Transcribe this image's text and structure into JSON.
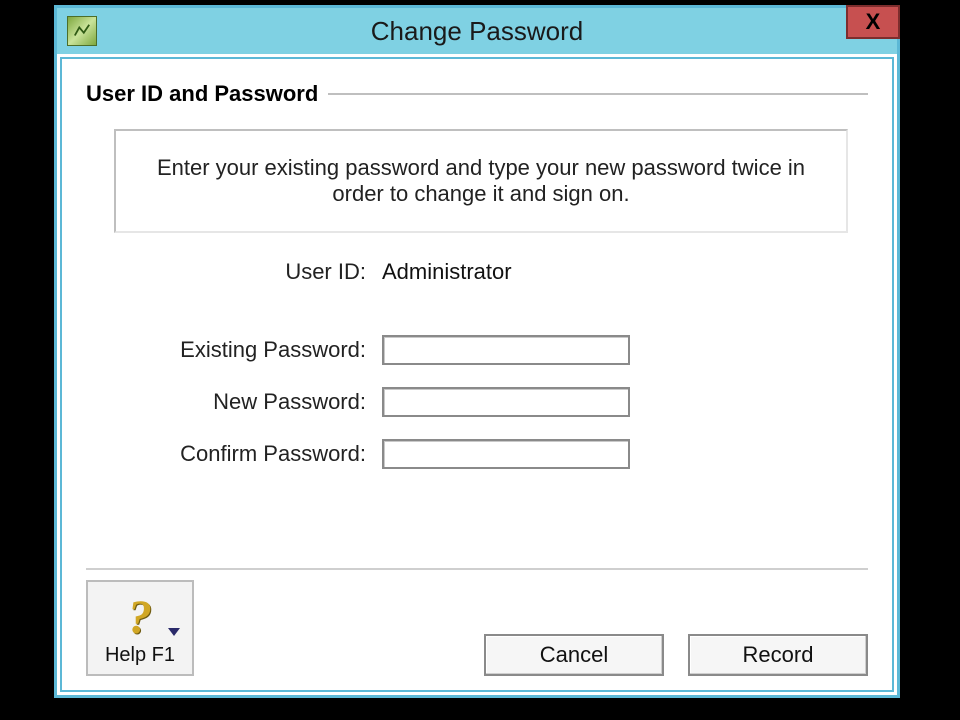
{
  "window": {
    "title": "Change Password",
    "close_symbol": "X"
  },
  "group_title": "User ID and Password",
  "instruction": "Enter your existing password and type your new password twice in order to change it and sign on.",
  "labels": {
    "user_id": "User ID:",
    "existing_password": "Existing Password:",
    "new_password": "New Password:",
    "confirm_password": "Confirm Password:"
  },
  "values": {
    "user_id": "Administrator",
    "existing_password": "",
    "new_password": "",
    "confirm_password": ""
  },
  "buttons": {
    "help": "Help F1",
    "cancel": "Cancel",
    "record": "Record"
  }
}
